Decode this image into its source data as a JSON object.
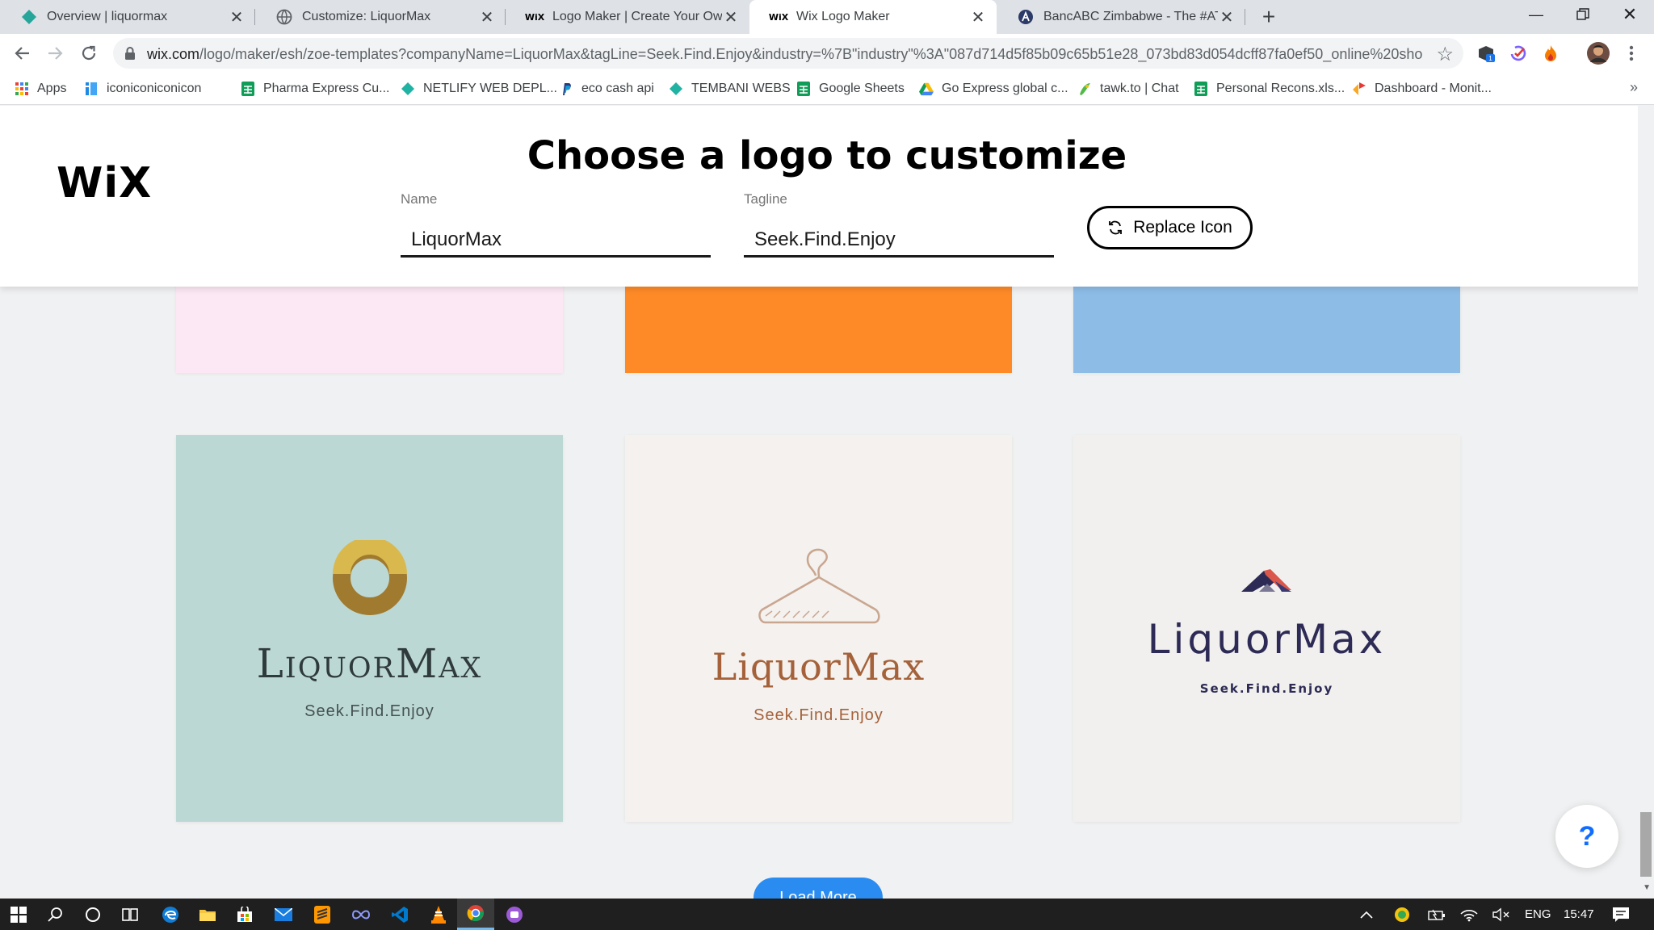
{
  "browser": {
    "tabs": [
      {
        "title": "Overview | liquormax",
        "icon": "wix-diamond-icon",
        "active": false
      },
      {
        "title": "Customize: LiquorMax",
        "icon": "globe-icon",
        "active": false
      },
      {
        "title": "Logo Maker | Create Your Own Fr",
        "icon": "wix-icon",
        "active": false
      },
      {
        "title": "Wix Logo Maker",
        "icon": "wix-icon",
        "active": true
      },
      {
        "title": "BancABC Zimbabwe - The #ATea",
        "icon": "a-circle-icon",
        "active": false
      }
    ],
    "url_host": "wix.com",
    "url_path": "/logo/maker/esh/zoe-templates?companyName=LiquorMax&tagLine=Seek.Find.Enjoy&industry=%7B\"industry\"%3A\"087d714d5f85b09c65b51e28_073bd83d054dcff87fa0ef50_online%20sho...",
    "extension_badge": "1",
    "bookmarks": [
      {
        "label": "Apps",
        "icon": "apps-grid-icon"
      },
      {
        "label": "iconiconiconicon",
        "icon": "iconicon-icon"
      },
      {
        "label": "Pharma Express Cu...",
        "icon": "sheets-icon"
      },
      {
        "label": "NETLIFY WEB DEPL...",
        "icon": "netlify-icon"
      },
      {
        "label": "eco cash api",
        "icon": "paypal-icon"
      },
      {
        "label": "TEMBANI WEBS",
        "icon": "netlify-icon"
      },
      {
        "label": "Google Sheets",
        "icon": "sheets-icon"
      },
      {
        "label": "Go Express global c...",
        "icon": "drive-icon"
      },
      {
        "label": "tawk.to | Chat",
        "icon": "tawk-icon"
      },
      {
        "label": "Personal Recons.xls...",
        "icon": "sheets-icon"
      },
      {
        "label": "Dashboard - Monit...",
        "icon": "dashboard-icon"
      }
    ],
    "bookmarks_more": "»"
  },
  "page": {
    "brand": "WiX",
    "heading": "Choose a logo to customize",
    "name_label": "Name",
    "name_value": "LiquorMax",
    "tagline_label": "Tagline",
    "tagline_value": "Seek.Find.Enjoy",
    "replace_icon_label": "Replace Icon",
    "help_label": "?",
    "load_more_label": "Load More"
  },
  "cards_top": [
    {
      "color": "#fce8f4"
    },
    {
      "color": "#fe8a27"
    },
    {
      "color": "#8dbde7"
    }
  ],
  "cards": [
    {
      "name": "LiquorMax",
      "tagline": "Seek.Find.Enjoy",
      "bg": "#bcd8d4",
      "name_color": "#2f3a3c",
      "tag_color": "#455254",
      "icon": "donut-ring-icon"
    },
    {
      "name": "LiquorMax",
      "tagline": "Seek.Find.Enjoy",
      "bg": "#f4f1ee",
      "name_color": "#a5623a",
      "tag_color": "#a5623a",
      "icon": "clothes-hanger-icon"
    },
    {
      "name": "LiquorMax",
      "tagline": "Seek.Find.Enjoy",
      "bg": "#f1f0ee",
      "name_color": "#2d2b55",
      "tag_color": "#2d2b55",
      "icon": "roof-chevron-icon"
    }
  ],
  "taskbar": {
    "lang": "ENG",
    "time": "15:47"
  }
}
